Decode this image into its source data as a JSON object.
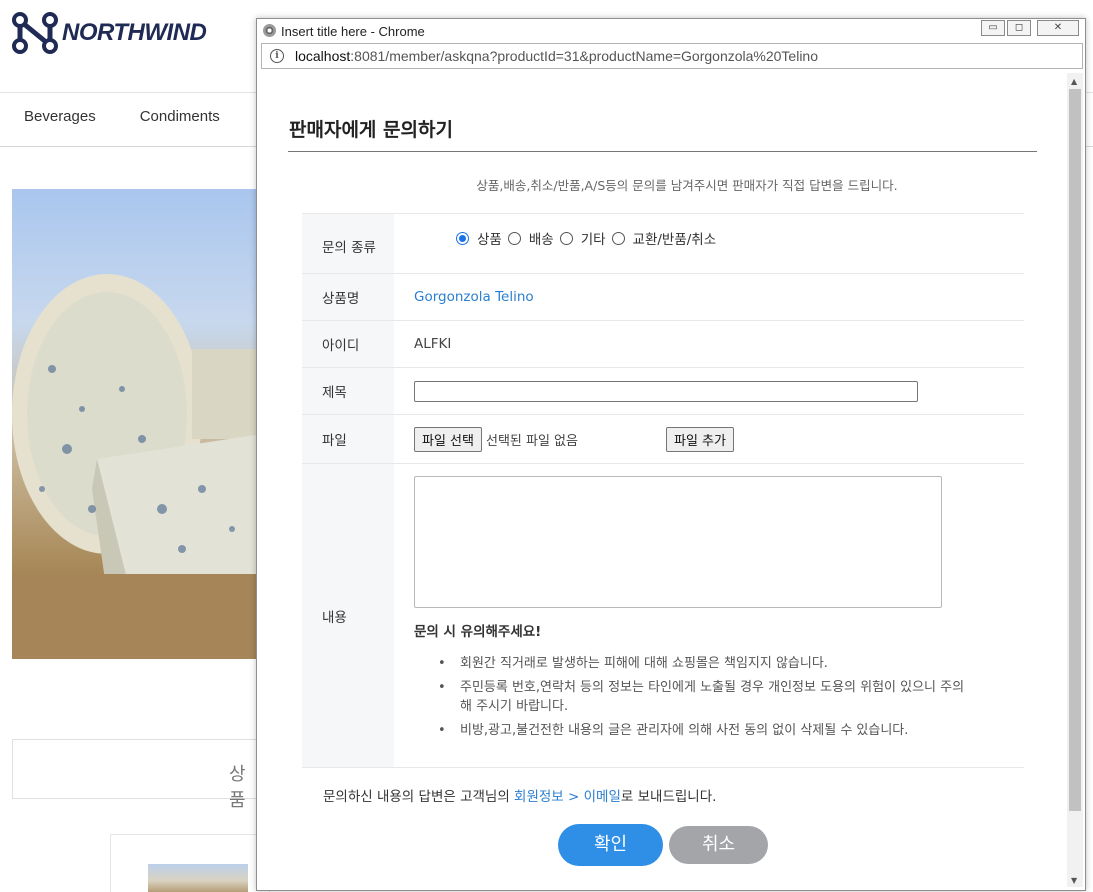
{
  "background": {
    "logo_text": "NORTHWIND",
    "nav": [
      "Beverages",
      "Condiments"
    ],
    "tab_label": "상품"
  },
  "window": {
    "title": "Insert title here - Chrome",
    "url_host": "localhost",
    "url_rest": ":8081/member/askqna?productId=31&productName=Gorgonzola%20Telino",
    "controls": {
      "minimize": "▭",
      "maximize": "◻",
      "close": "✕"
    }
  },
  "page": {
    "title": "판매자에게 문의하기",
    "notice": "상품,배송,취소/반품,A/S등의 문의를 남겨주시면 판매자가 직접 답변을 드립니다."
  },
  "form": {
    "type_label": "문의 종류",
    "type_options": [
      "상품",
      "배송",
      "기타",
      "교환/반품/취소"
    ],
    "type_selected": "상품",
    "product_label": "상품명",
    "product_name": "Gorgonzola Telino",
    "id_label": "아이디",
    "user_id": "ALFKI",
    "subject_label": "제목",
    "subject_value": "",
    "file_label": "파일",
    "file_choose": "파일 선택",
    "file_none": "선택된 파일 없음",
    "file_add": "파일 추가",
    "content_label": "내용",
    "content_value": "",
    "caution_title": "문의 시 유의해주세요!",
    "cautions": [
      "회원간 직거래로 발생하는 피해에 대해 쇼핑몰은 책임지지 않습니다.",
      "주민등록 번호,연락처 등의 정보는 타인에게 노출될 경우 개인정보 도용의 위험이 있으니 주의해 주시기 바랍니다.",
      "비방,광고,불건전한 내용의 글은 관리자에 의해 사전 동의 없이 삭제될 수 있습니다."
    ]
  },
  "reply": {
    "before": "문의하신 내용의 답변은 고객님의 ",
    "link": "회원정보 > 이메일",
    "after": "로 보내드립니다."
  },
  "buttons": {
    "confirm": "확인",
    "cancel": "취소"
  },
  "colors": {
    "accent": "#2f8fe6",
    "cancel": "#a3a5a9",
    "link": "#2a7fd0",
    "radio": "#1a73e8"
  }
}
